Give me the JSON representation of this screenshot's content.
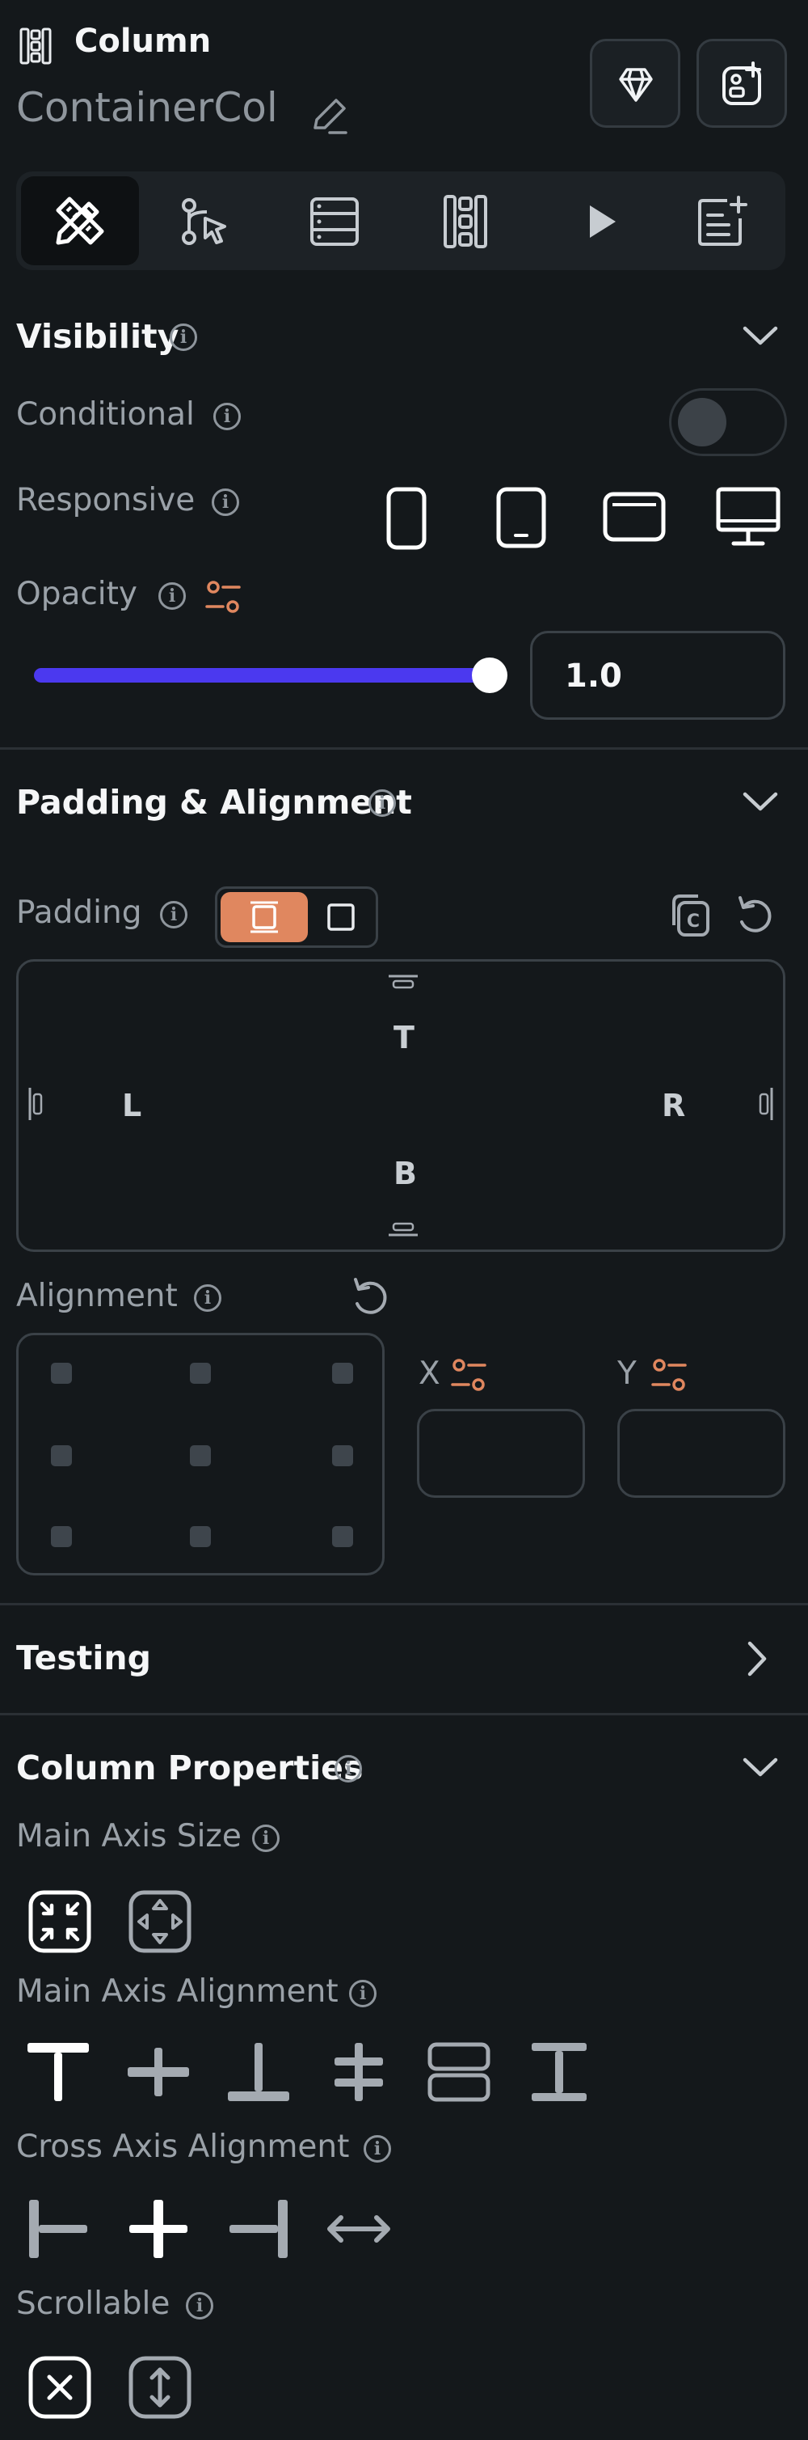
{
  "header": {
    "widget_type": "Column",
    "widget_name": "ContainerCol"
  },
  "toolbar": {
    "tabs": [
      "properties-icon",
      "actions-icon",
      "backend-query-icon",
      "widget-tree-icon",
      "run-icon",
      "generate-icon"
    ]
  },
  "visibility": {
    "title": "Visibility",
    "conditional_label": "Conditional",
    "responsive_label": "Responsive",
    "opacity_label": "Opacity",
    "opacity_value": "1.0",
    "opacity_fraction": 1.0,
    "devices": [
      "phone-icon",
      "tablet-icon",
      "tablet-landscape-icon",
      "desktop-icon"
    ]
  },
  "padding_alignment": {
    "title": "Padding & Alignment",
    "padding_label": "Padding",
    "top": "T",
    "left": "L",
    "right": "R",
    "bottom": "B",
    "alignment_label": "Alignment",
    "x_label": "X",
    "y_label": "Y"
  },
  "testing": {
    "title": "Testing"
  },
  "column_properties": {
    "title": "Column Properties",
    "main_axis_size_label": "Main Axis Size",
    "main_axis_alignment_label": "Main Axis Alignment",
    "cross_axis_alignment_label": "Cross Axis Alignment",
    "scrollable_label": "Scrollable"
  },
  "colors": {
    "background": "#14181b",
    "accent": "#e0875f",
    "slider": "#4b39ef",
    "muted_text": "#9aa1a8"
  }
}
